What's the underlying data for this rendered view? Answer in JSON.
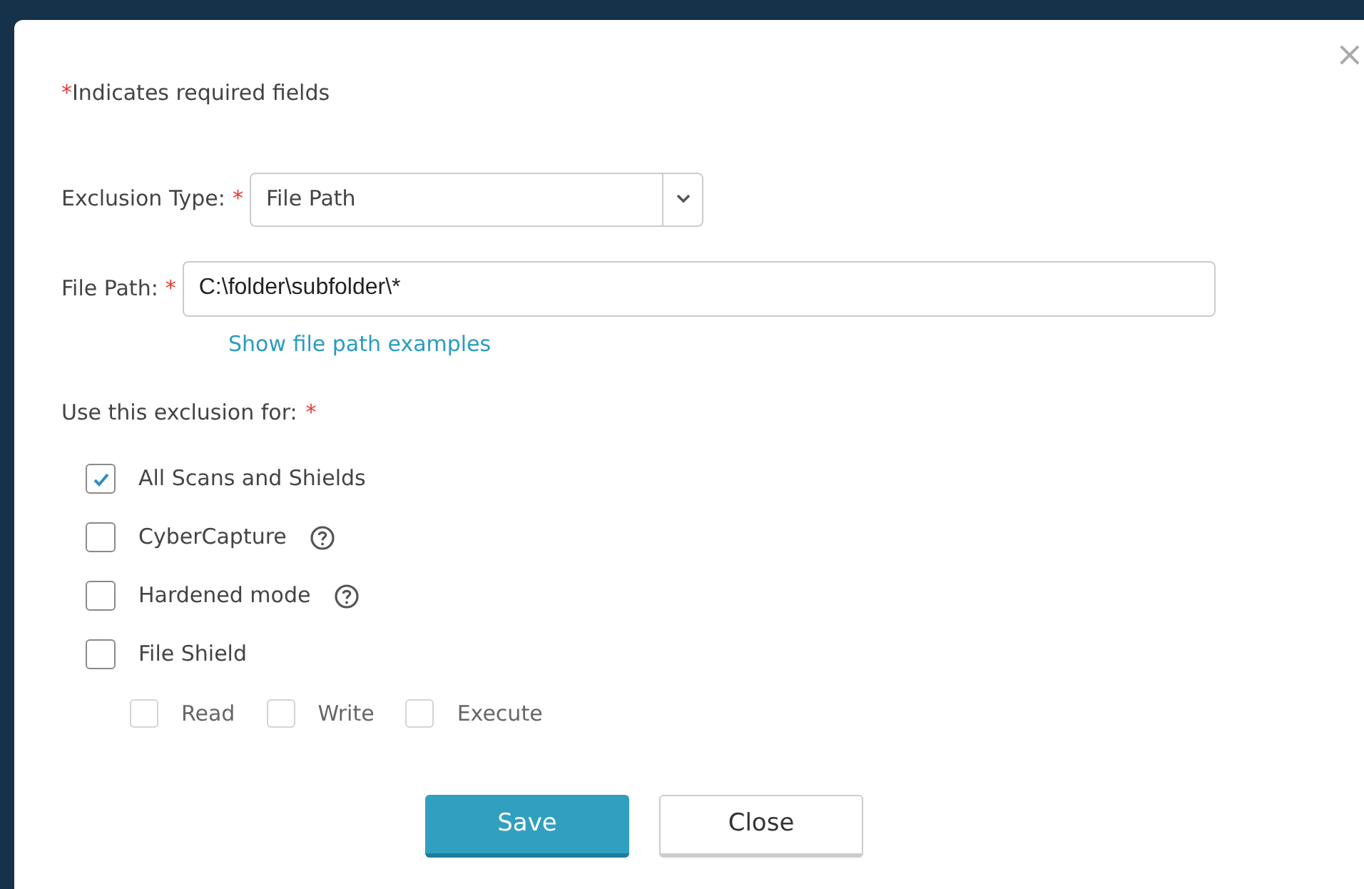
{
  "dialog": {
    "close_glyph": "×",
    "note": {
      "mark": "*",
      "text": "Indicates required fields"
    },
    "exclusion_type": {
      "label": "Exclusion Type:",
      "mark": "*",
      "value": "File Path"
    },
    "file_path": {
      "label": "File Path:",
      "mark": "*",
      "value": "C:\\folder\\subfolder\\*",
      "link": "Show file path examples"
    },
    "use_for": {
      "label": "Use this exclusion for:",
      "mark": "*"
    },
    "options": [
      {
        "label": "All Scans and Shields",
        "checked": true,
        "help": false
      },
      {
        "label": "CyberCapture",
        "checked": false,
        "help": true
      },
      {
        "label": "Hardened mode",
        "checked": false,
        "help": true
      },
      {
        "label": "File Shield",
        "checked": false,
        "help": false,
        "children": [
          {
            "label": "Read",
            "checked": false,
            "disabled": true
          },
          {
            "label": "Write",
            "checked": false,
            "disabled": true
          },
          {
            "label": "Execute",
            "checked": false,
            "disabled": true
          }
        ]
      }
    ],
    "buttons": [
      {
        "label": "Save",
        "kind": "primary"
      },
      {
        "label": "Close",
        "kind": "secondary"
      }
    ]
  }
}
